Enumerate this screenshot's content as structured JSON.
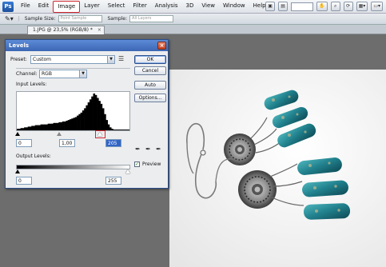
{
  "app": {
    "logo": "Ps"
  },
  "menu": {
    "items": [
      "File",
      "Edit",
      "Image",
      "Layer",
      "Select",
      "Filter",
      "Analysis",
      "3D",
      "View",
      "Window",
      "Help"
    ],
    "active": "Image"
  },
  "options_bar": {
    "sample_size_label": "Sample Size:",
    "sample_size_value": "Point Sample",
    "sample_label": "Sample:",
    "sample_value": "All Layers"
  },
  "document_tab": {
    "title": "1.JPG @ 23,5% (RGB/8) *",
    "close": "×"
  },
  "dialog": {
    "title": "Levels",
    "close": "×",
    "preset_label": "Preset:",
    "preset_value": "Custom",
    "channel_label": "Channel:",
    "channel_value": "RGB",
    "input_levels_label": "Input Levels:",
    "input_black": "0",
    "input_gamma": "1,00",
    "input_white": "205",
    "output_levels_label": "Output Levels:",
    "output_black": "0",
    "output_white": "255",
    "buttons": {
      "ok": "OK",
      "cancel": "Cancel",
      "auto": "Auto",
      "options": "Options..."
    },
    "preview_label": "Preview",
    "preview_checked": true
  },
  "histogram": {
    "bins": [
      2,
      2,
      3,
      3,
      4,
      4,
      5,
      5,
      6,
      6,
      7,
      7,
      7,
      8,
      8,
      8,
      8,
      9,
      9,
      9,
      10,
      10,
      10,
      11,
      11,
      12,
      12,
      13,
      14,
      15,
      16,
      17,
      18,
      20,
      22,
      24,
      27,
      30,
      34,
      38,
      42,
      46,
      50,
      48,
      44,
      40,
      36,
      30,
      22,
      14,
      8,
      4,
      2,
      1,
      1,
      1,
      1,
      1,
      1,
      1,
      1,
      1
    ],
    "max": 50
  },
  "colors": {
    "accent": "#3165c5",
    "highlight": "#d0282f",
    "title_bar": "#4a78c6"
  }
}
